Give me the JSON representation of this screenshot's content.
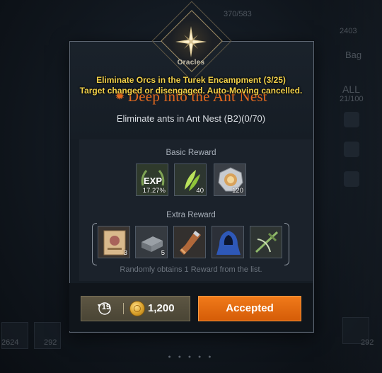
{
  "notifications": {
    "quest_progress": "Eliminate Orcs in the Turek Encampment (3/25)",
    "auto_move": "Target changed or disengaged. Auto-Moving cancelled."
  },
  "emblem": {
    "label": "Oracles"
  },
  "quest": {
    "title": "Deep into the Ant Nest",
    "description": "Eliminate ants in Ant Nest (B2)(0/70)"
  },
  "basic_reward": {
    "label": "Basic Reward",
    "items": [
      {
        "icon": "exp-laurel-icon",
        "icon_text": "EXP",
        "qty": "17.27%"
      },
      {
        "icon": "green-feather-icon",
        "qty": "40"
      },
      {
        "icon": "silver-shield-medal-icon",
        "qty": "120"
      }
    ]
  },
  "extra_reward": {
    "label": "Extra Reward",
    "items": [
      {
        "icon": "wanted-poster-icon",
        "qty": "3"
      },
      {
        "icon": "iron-ingot-icon",
        "qty": "5"
      },
      {
        "icon": "leather-gauntlet-icon",
        "qty": ""
      },
      {
        "icon": "blue-hooded-cloak-icon",
        "qty": ""
      },
      {
        "icon": "green-crossbow-icon",
        "qty": ""
      }
    ],
    "note": "Randomly obtains 1 Reward from the list."
  },
  "footer": {
    "refresh_count": "19",
    "cost": "1,200",
    "accept_label": "Accepted"
  },
  "background": {
    "top_count": "370/583",
    "top_right_count": "2403",
    "bag_label": "Bag",
    "all_label": "ALL",
    "all_count": "21/100",
    "bottom_left_count": "2624",
    "bottom_left_count_2": "292",
    "bottom_right_count": "292"
  },
  "colors": {
    "title": "#e46a1e",
    "notice": "#f2d14a",
    "accept_button": "#e46a12"
  }
}
